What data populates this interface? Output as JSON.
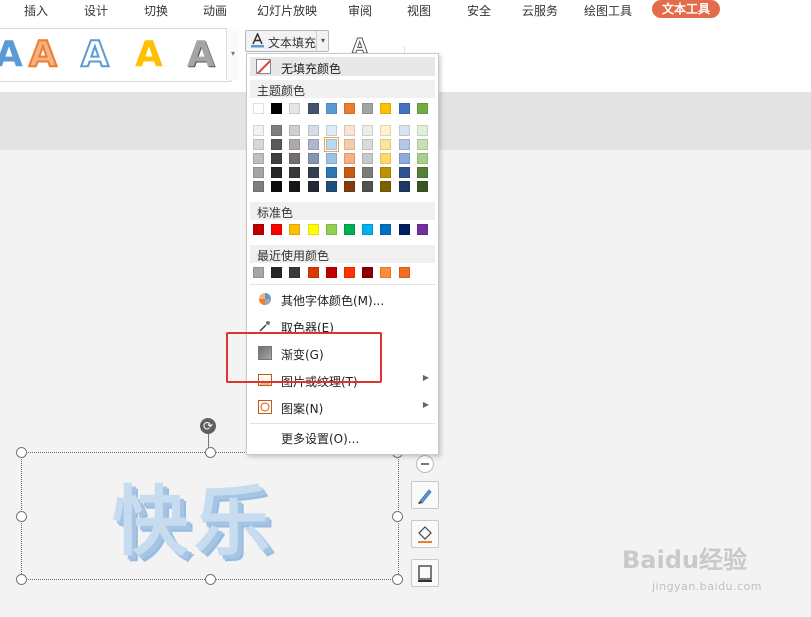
{
  "menubar": {
    "items": [
      "插入",
      "设计",
      "切换",
      "动画",
      "幻灯片放映",
      "审阅",
      "视图",
      "安全",
      "云服务",
      "绘图工具",
      "文本工具"
    ]
  },
  "ribbon": {
    "style_letters": [
      "A",
      "A",
      "A",
      "A",
      "A"
    ],
    "text_fill_label": "文本填充",
    "outline_letter": "A"
  },
  "dropdown": {
    "no_fill": "无填充颜色",
    "theme_colors_title": "主题颜色",
    "standard_colors_title": "标准色",
    "recent_colors_title": "最近使用颜色",
    "theme_top": [
      "#ffffff",
      "#000000",
      "#e7e6e6",
      "#44546a",
      "#5b9bd5",
      "#ed7d31",
      "#a5a5a5",
      "#ffc000",
      "#4472c4",
      "#70ad47"
    ],
    "theme_shades": [
      [
        "#f2f2f2",
        "#7f7f7f",
        "#d0cece",
        "#d6dce4",
        "#deebf6",
        "#fbe4d5",
        "#ededed",
        "#fff2cc",
        "#dae3f3",
        "#e2efd9"
      ],
      [
        "#d8d8d8",
        "#595959",
        "#aeaaaa",
        "#adb9ca",
        "#bdd7ee",
        "#f7caac",
        "#dbdbdb",
        "#ffe599",
        "#b4c6e7",
        "#c5e0b3"
      ],
      [
        "#bfbfbf",
        "#3f3f3f",
        "#757070",
        "#8496b0",
        "#9cc3e5",
        "#f4b183",
        "#c9c9c9",
        "#ffd965",
        "#8faadc",
        "#a8d08d"
      ],
      [
        "#a5a5a5",
        "#262626",
        "#3a3838",
        "#323f4f",
        "#2e75b5",
        "#c55a11",
        "#7b7b7b",
        "#bf9000",
        "#2f5496",
        "#538135"
      ],
      [
        "#7f7f7f",
        "#0c0c0c",
        "#171616",
        "#222a35",
        "#1e4e79",
        "#833c0b",
        "#525252",
        "#7f6000",
        "#1f3864",
        "#375623"
      ]
    ],
    "standard": [
      "#c00000",
      "#ff0000",
      "#ffc000",
      "#ffff00",
      "#92d050",
      "#00b050",
      "#00b0f0",
      "#0070c0",
      "#002060",
      "#7030a0"
    ],
    "recent": [
      "#a6a6a6",
      "#262626",
      "#3a3838",
      "#d83b01",
      "#c00000",
      "#ff3300",
      "#8b0000",
      "#ff8c3a",
      "#f26d21"
    ],
    "more_font_colors": "其他字体颜色(M)...",
    "eyedropper": "取色器(E)",
    "gradient": "渐变(G)",
    "picture_texture": "图片或纹理(T)",
    "pattern": "图案(N)",
    "more_settings": "更多设置(O)..."
  },
  "canvas": {
    "wordart_text": "快乐"
  },
  "watermark": {
    "main": "Baidu经验",
    "sub": "jingyan.baidu.com"
  }
}
